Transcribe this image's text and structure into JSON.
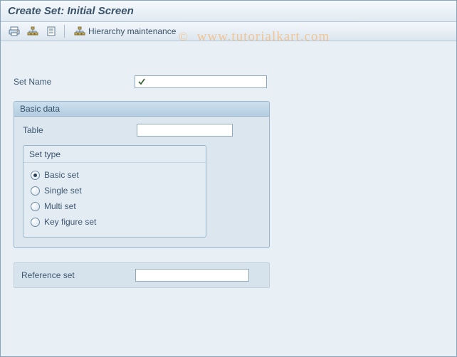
{
  "title": "Create Set: Initial Screen",
  "watermark": "www.tutorialkart.com",
  "toolbar": {
    "hierarchy_label": "Hierarchy maintenance"
  },
  "form": {
    "set_name_label": "Set Name",
    "set_name_value": "",
    "reference_set_label": "Reference set",
    "reference_set_value": ""
  },
  "basic_data": {
    "header": "Basic data",
    "table_label": "Table",
    "table_value": "",
    "set_type": {
      "header": "Set type",
      "options": [
        {
          "label": "Basic set",
          "selected": true
        },
        {
          "label": "Single set",
          "selected": false
        },
        {
          "label": "Multi set",
          "selected": false
        },
        {
          "label": "Key figure set",
          "selected": false
        }
      ]
    }
  }
}
